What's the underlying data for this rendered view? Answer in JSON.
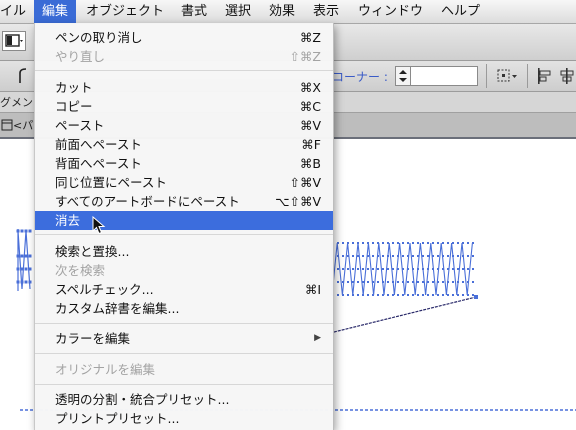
{
  "menubar": {
    "items": [
      "イル",
      "編集",
      "オブジェクト",
      "書式",
      "選択",
      "効果",
      "表示",
      "ウィンドウ",
      "ヘルプ"
    ],
    "active_index": 1
  },
  "toolbar": {
    "corner_label": "コーナー :",
    "corner_value": ""
  },
  "panel": {
    "label": "グメン"
  },
  "tab": {
    "label": "<パ"
  },
  "edit_menu": {
    "items": [
      {
        "label": "ペンの取り消し",
        "shortcut": "⌘Z",
        "disabled": false
      },
      {
        "label": "やり直し",
        "shortcut": "⇧⌘Z",
        "disabled": true
      },
      {
        "separator": true
      },
      {
        "label": "カット",
        "shortcut": "⌘X",
        "disabled": false
      },
      {
        "label": "コピー",
        "shortcut": "⌘C",
        "disabled": false
      },
      {
        "label": "ペースト",
        "shortcut": "⌘V",
        "disabled": false
      },
      {
        "label": "前面へペースト",
        "shortcut": "⌘F",
        "disabled": false
      },
      {
        "label": "背面へペースト",
        "shortcut": "⌘B",
        "disabled": false
      },
      {
        "label": "同じ位置にペースト",
        "shortcut": "⇧⌘V",
        "disabled": false
      },
      {
        "label": "すべてのアートボードにペースト",
        "shortcut": "⌥⇧⌘V",
        "disabled": false
      },
      {
        "label": "消去",
        "shortcut": "",
        "disabled": false,
        "selected": true
      },
      {
        "separator": true
      },
      {
        "label": "検索と置換...",
        "shortcut": "",
        "disabled": false
      },
      {
        "label": "次を検索",
        "shortcut": "",
        "disabled": true
      },
      {
        "label": "スペルチェック...",
        "shortcut": "⌘I",
        "disabled": false
      },
      {
        "label": "カスタム辞書を編集...",
        "shortcut": "",
        "disabled": false
      },
      {
        "separator": true
      },
      {
        "label": "カラーを編集",
        "shortcut": "▶",
        "disabled": false,
        "submenu": true
      },
      {
        "separator": true
      },
      {
        "label": "オリジナルを編集",
        "shortcut": "",
        "disabled": true
      },
      {
        "separator": true
      },
      {
        "label": "透明の分割・統合プリセット...",
        "shortcut": "",
        "disabled": false
      },
      {
        "label": "プリントプリセット...",
        "shortcut": "",
        "disabled": false
      }
    ]
  },
  "colors": {
    "accent": "#3c6ddd",
    "artwork": "#4a6fd8",
    "guide_line": "#2a2a6a"
  }
}
